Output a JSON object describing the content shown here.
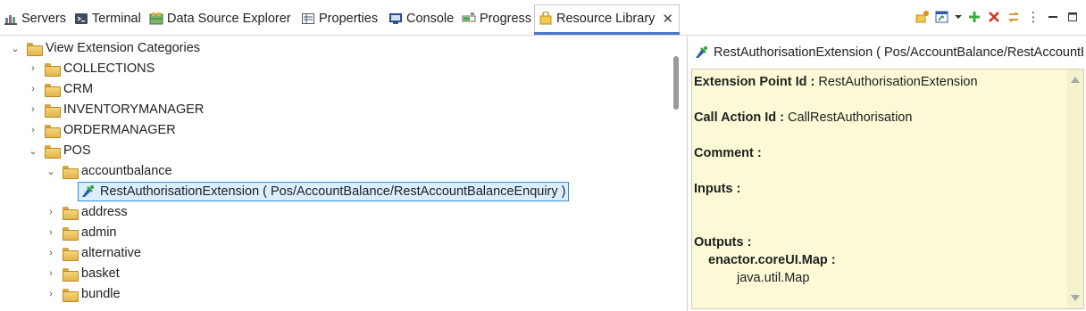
{
  "tabs": [
    {
      "label": "Servers",
      "icon": "servers-icon"
    },
    {
      "label": "Terminal",
      "icon": "terminal-icon"
    },
    {
      "label": "Data Source Explorer",
      "icon": "data-source-icon"
    },
    {
      "label": "Properties",
      "icon": "properties-icon"
    },
    {
      "label": "Console",
      "icon": "console-icon"
    },
    {
      "label": "Progress",
      "icon": "progress-icon"
    },
    {
      "label": "Resource Library",
      "icon": "resource-library-icon",
      "active": true
    }
  ],
  "close_glyph": "✕",
  "toolbar": {
    "view_menu_glyph": "⋮",
    "minimize_glyph": "▭",
    "maximize_glyph": "□"
  },
  "tree": {
    "root": "View Extension Categories",
    "items": [
      {
        "label": "COLLECTIONS",
        "expanded": false
      },
      {
        "label": "CRM",
        "expanded": false
      },
      {
        "label": "INVENTORYMANAGER",
        "expanded": false
      },
      {
        "label": "ORDERMANAGER",
        "expanded": false
      },
      {
        "label": "POS",
        "expanded": true
      }
    ],
    "pos_children": [
      {
        "label": "accountbalance",
        "expanded": true
      },
      {
        "label": "address",
        "expanded": false
      },
      {
        "label": "admin",
        "expanded": false
      },
      {
        "label": "alternative",
        "expanded": false
      },
      {
        "label": "basket",
        "expanded": false
      },
      {
        "label": "bundle",
        "expanded": false
      }
    ],
    "selected_extension": "RestAuthorisationExtension ( Pos/AccountBalance/RestAccountBalanceEnquiry )"
  },
  "detail": {
    "header": "RestAuthorisationExtension ( Pos/AccountBalance/RestAccountBalanceEnquiry )",
    "extension_point_label": "Extension Point Id :",
    "extension_point_value": "RestAuthorisationExtension",
    "call_action_label": "Call Action Id :",
    "call_action_value": "CallRestAuthorisation",
    "comment_label": "Comment :",
    "inputs_label": "Inputs :",
    "outputs_label": "Outputs :",
    "output_key": "enactor.coreUI.Map :",
    "output_type": "java.util.Map"
  },
  "colors": {
    "selection_bg": "#dbeefe",
    "selection_border": "#2f8ddf",
    "detail_bg": "#fcfad6",
    "active_tab_accent": "#4a78c2"
  }
}
